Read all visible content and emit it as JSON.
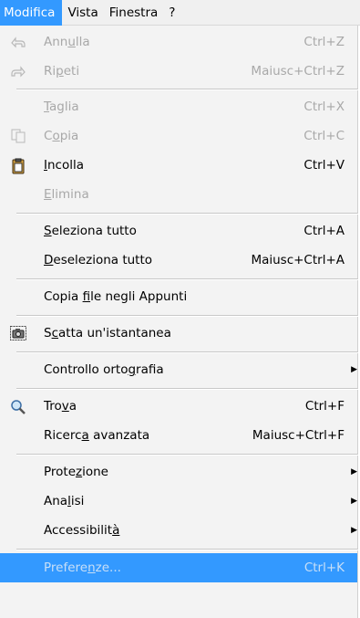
{
  "menubar": {
    "items": [
      "Modifica",
      "Vista",
      "Finestra",
      "?"
    ]
  },
  "menu": {
    "items": [
      {
        "pre": "Ann",
        "mk": "u",
        "post": "lla",
        "shortcut": "Ctrl+Z",
        "icon": "undo-icon",
        "enabled": false
      },
      {
        "pre": "Ri",
        "mk": "p",
        "post": "eti",
        "shortcut": "Maiusc+Ctrl+Z",
        "icon": "redo-icon",
        "enabled": false
      },
      {
        "pre": "",
        "mk": "T",
        "post": "aglia",
        "shortcut": "Ctrl+X",
        "icon": "",
        "enabled": false
      },
      {
        "pre": "C",
        "mk": "o",
        "post": "pia",
        "shortcut": "Ctrl+C",
        "icon": "copy-icon",
        "enabled": false
      },
      {
        "pre": "",
        "mk": "I",
        "post": "ncolla",
        "shortcut": "Ctrl+V",
        "icon": "paste-icon",
        "enabled": true
      },
      {
        "pre": "",
        "mk": "E",
        "post": "limina",
        "shortcut": "",
        "icon": "",
        "enabled": false
      },
      {
        "pre": "",
        "mk": "S",
        "post": "eleziona tutto",
        "shortcut": "Ctrl+A",
        "icon": "",
        "enabled": true
      },
      {
        "pre": "",
        "mk": "D",
        "post": "eseleziona tutto",
        "shortcut": "Maiusc+Ctrl+A",
        "icon": "",
        "enabled": true
      },
      {
        "pre": "Copia ",
        "mk": "f",
        "post": "ile negli Appunti",
        "shortcut": "",
        "icon": "",
        "enabled": true
      },
      {
        "pre": "S",
        "mk": "c",
        "post": "atta un'istantanea",
        "shortcut": "",
        "icon": "camera-icon",
        "enabled": true
      },
      {
        "pre": "Controllo orto",
        "mk": "g",
        "post": "rafia",
        "shortcut": "",
        "icon": "",
        "enabled": true,
        "submenu": true
      },
      {
        "pre": "Tro",
        "mk": "v",
        "post": "a",
        "shortcut": "Ctrl+F",
        "icon": "search-icon",
        "enabled": true
      },
      {
        "pre": "Ricerc",
        "mk": "a",
        "post": " avanzata",
        "shortcut": "Maiusc+Ctrl+F",
        "icon": "",
        "enabled": true
      },
      {
        "pre": "Prote",
        "mk": "z",
        "post": "ione",
        "shortcut": "",
        "icon": "",
        "enabled": true,
        "submenu": true
      },
      {
        "pre": "Ana",
        "mk": "l",
        "post": "isi",
        "shortcut": "",
        "icon": "",
        "enabled": true,
        "submenu": true
      },
      {
        "pre": "Accessibilit",
        "mk": "à",
        "post": "",
        "shortcut": "",
        "icon": "",
        "enabled": true,
        "submenu": true
      },
      {
        "pre": "Prefere",
        "mk": "n",
        "post": "ze...",
        "shortcut": "Ctrl+K",
        "icon": "",
        "enabled": true,
        "selected": true
      }
    ]
  },
  "colors": {
    "highlight": "#3399ff",
    "disabled_text": "#a8a8a8"
  }
}
